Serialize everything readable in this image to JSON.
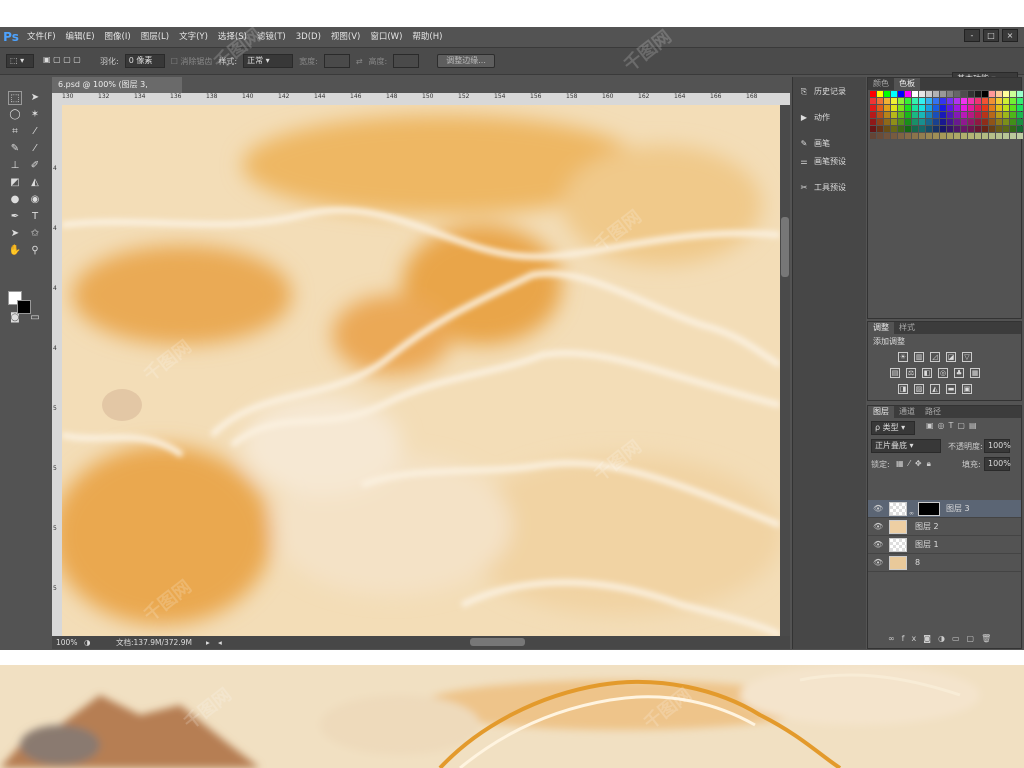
{
  "app": {
    "logo": "Ps"
  },
  "menu": [
    "文件(F)",
    "编辑(E)",
    "图像(I)",
    "图层(L)",
    "文字(Y)",
    "选择(S)",
    "滤镜(T)",
    "3D(D)",
    "视图(V)",
    "窗口(W)",
    "帮助(H)"
  ],
  "window_buttons": [
    "-",
    "□",
    "×"
  ],
  "options": {
    "feather_label": "羽化:",
    "feather_value": "0 像素",
    "antialias_label": "消除锯齿",
    "style_label": "样式:",
    "style_value": "正常",
    "width_label": "宽度:",
    "height_label": "高度:",
    "refine_edge": "调整边缘...",
    "workspace": "基本功能"
  },
  "document": {
    "tab_title": "6.psd @ 100% (图层 3, RGB/8#)",
    "ruler_h": [
      "130",
      "132",
      "134",
      "136",
      "138",
      "140",
      "142",
      "144",
      "146",
      "148",
      "150",
      "152",
      "154",
      "156",
      "158",
      "160",
      "162",
      "164",
      "166",
      "168"
    ],
    "ruler_v": [
      "4",
      "4",
      "4",
      "4",
      "5",
      "5",
      "5",
      "5",
      "5"
    ],
    "zoom": "100%",
    "doc_info": "文档:137.9M/372.9M"
  },
  "mid_panel": {
    "items": [
      "历史记录",
      "动作",
      "画笔",
      "画笔预设",
      "工具预设"
    ]
  },
  "color_panel": {
    "tabs": [
      "颜色",
      "色板"
    ]
  },
  "adjust_panel": {
    "tabs": [
      "调整",
      "样式"
    ],
    "title": "添加调整"
  },
  "layers_panel": {
    "tabs": [
      "图层",
      "通道",
      "路径"
    ],
    "kind_label": "ρ 类型",
    "blend_mode": "正片叠底",
    "opacity_label": "不透明度:",
    "opacity_value": "100%",
    "lock_label": "锁定:",
    "fill_label": "填充:",
    "fill_value": "100%",
    "layers": [
      {
        "name": "图层 3"
      },
      {
        "name": "图层 2"
      },
      {
        "name": "图层 1"
      },
      {
        "name": "8"
      }
    ]
  },
  "watermark": "千图网"
}
